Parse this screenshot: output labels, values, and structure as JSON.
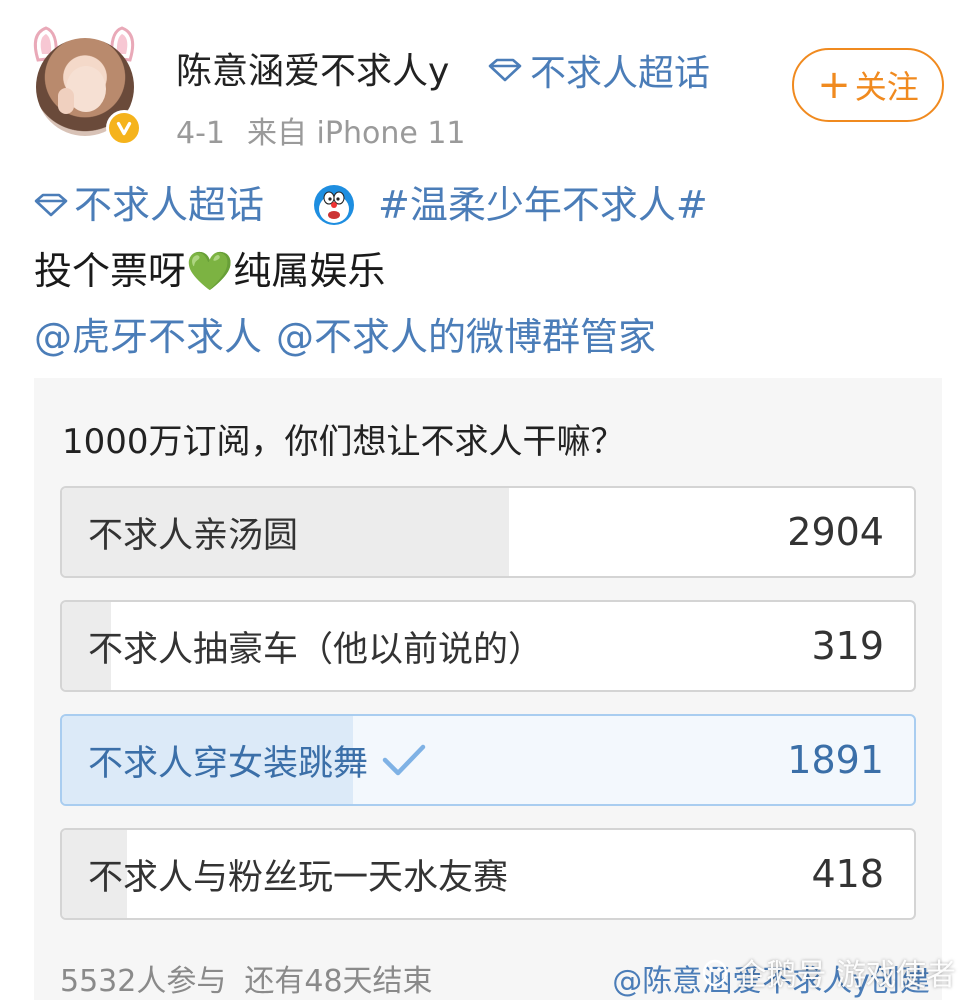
{
  "header": {
    "username": "陈意涵爱不求人y",
    "supertopic_label": "不求人超话",
    "date": "4-1",
    "source": "来自 iPhone 11",
    "follow_label": "关注",
    "follow_plus": "+"
  },
  "post": {
    "supertopic_link": "不求人超话",
    "hashtag": "#温柔少年不求人#",
    "text_before_emoji": "投个票呀",
    "emoji": "💚",
    "text_after_emoji": "纯属娱乐",
    "mention_1": "@虎牙不求人",
    "mention_2": "@不求人的微博群管家"
  },
  "poll": {
    "title": "1000万订阅，你们想让不求人干嘛？",
    "options": [
      {
        "label": "不求人亲汤圆",
        "count": "2904",
        "fraction": 0.525,
        "selected": false
      },
      {
        "label": "不求人抽豪车（他以前说的）",
        "count": "319",
        "fraction": 0.058,
        "selected": false
      },
      {
        "label": "不求人穿女装跳舞",
        "count": "1891",
        "fraction": 0.342,
        "selected": true
      },
      {
        "label": "不求人与粉丝玩一天水友赛",
        "count": "418",
        "fraction": 0.076,
        "selected": false
      }
    ],
    "participants": "5532人参与",
    "remaining": "还有48天结束",
    "creator": "@陈意涵爱不求人y创建"
  },
  "watermark": {
    "text": "企鹅号 游戏使者"
  },
  "colors": {
    "link_blue": "#4b7db8",
    "follow_orange": "#f08a1f",
    "verified_gold": "#f5b31c",
    "check_blue": "#7fb2e5"
  },
  "icons": {
    "supertopic": "diamond-icon",
    "verified": "verified-badge-icon",
    "check": "check-icon",
    "emoji_face": "doraemon-icon"
  }
}
